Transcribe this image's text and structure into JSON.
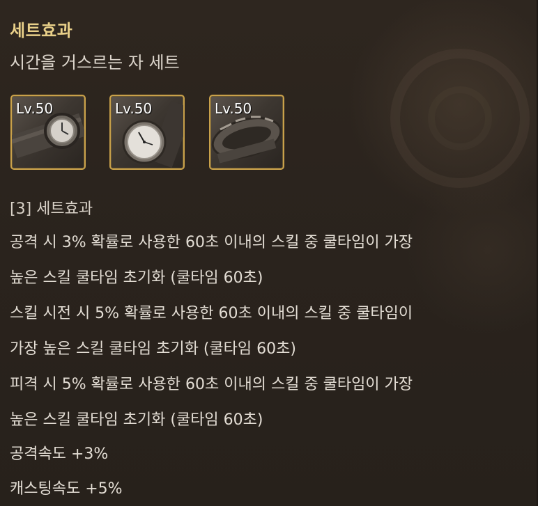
{
  "header": {
    "title": "세트효과",
    "set_name": "시간을 거스르는 자 세트"
  },
  "items": [
    {
      "level": "Lv.50",
      "icon": "wristwatch-icon"
    },
    {
      "level": "Lv.50",
      "icon": "pocket-watch-icon"
    },
    {
      "level": "Lv.50",
      "icon": "bracelet-icon"
    }
  ],
  "effects": {
    "header": "[3] 세트효과",
    "lines": [
      "공격 시 3% 확률로 사용한 60초 이내의 스킬 중 쿨타임이 가장",
      "높은 스킬 쿨타임 초기화 (쿨타임 60초)",
      "스킬 시전 시 5% 확률로 사용한 60초 이내의 스킬 중 쿨타임이",
      "가장 높은 스킬 쿨타임 초기화 (쿨타임 60초)",
      "피격 시 5% 확률로 사용한 60초 이내의 스킬 중 쿨타임이 가장",
      "높은 스킬 쿨타임 초기화 (쿨타임 60초)",
      "공격속도 +3%",
      "캐스팅속도 +5%"
    ]
  },
  "colors": {
    "title": "#e9d089",
    "item_border": "#c9a14a",
    "text": "#e3ddd4"
  }
}
